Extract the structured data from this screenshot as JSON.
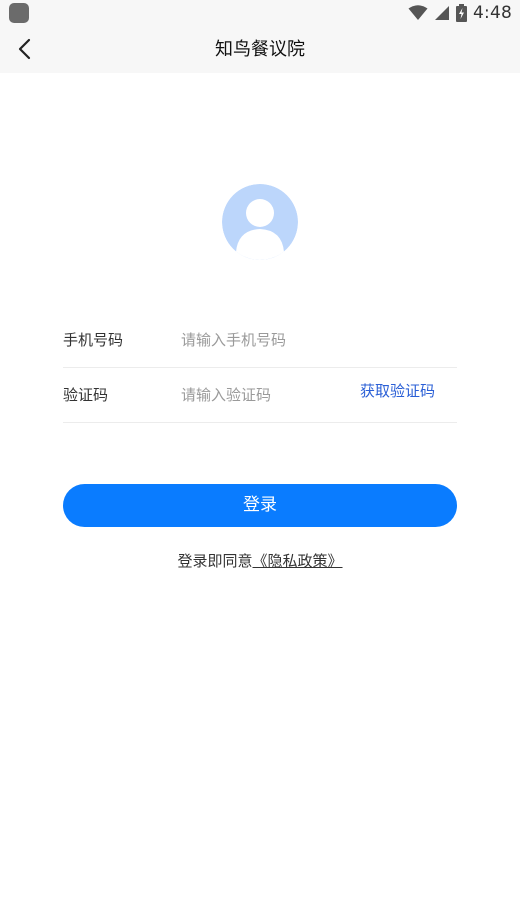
{
  "status_bar": {
    "time": "4:48",
    "icons": [
      "app-notification-icon",
      "wifi-icon",
      "cellular-signal-icon",
      "battery-charging-icon"
    ]
  },
  "nav": {
    "title": "知鸟餐议院",
    "back_icon": "chevron-left-icon"
  },
  "avatar": {
    "icon": "user-avatar-icon",
    "color": "#bcd6fb"
  },
  "form": {
    "phone": {
      "label": "手机号码",
      "placeholder": "请输入手机号码",
      "value": ""
    },
    "code": {
      "label": "验证码",
      "placeholder": "请输入验证码",
      "value": "",
      "get_code_label": "获取验证码"
    }
  },
  "login_button": {
    "label": "登录"
  },
  "agreement": {
    "prefix": "登录即同意",
    "link": "《隐私政策》"
  },
  "colors": {
    "primary": "#0a7cff",
    "link": "#2a5fd6",
    "bar_background": "#f7f7f7"
  }
}
